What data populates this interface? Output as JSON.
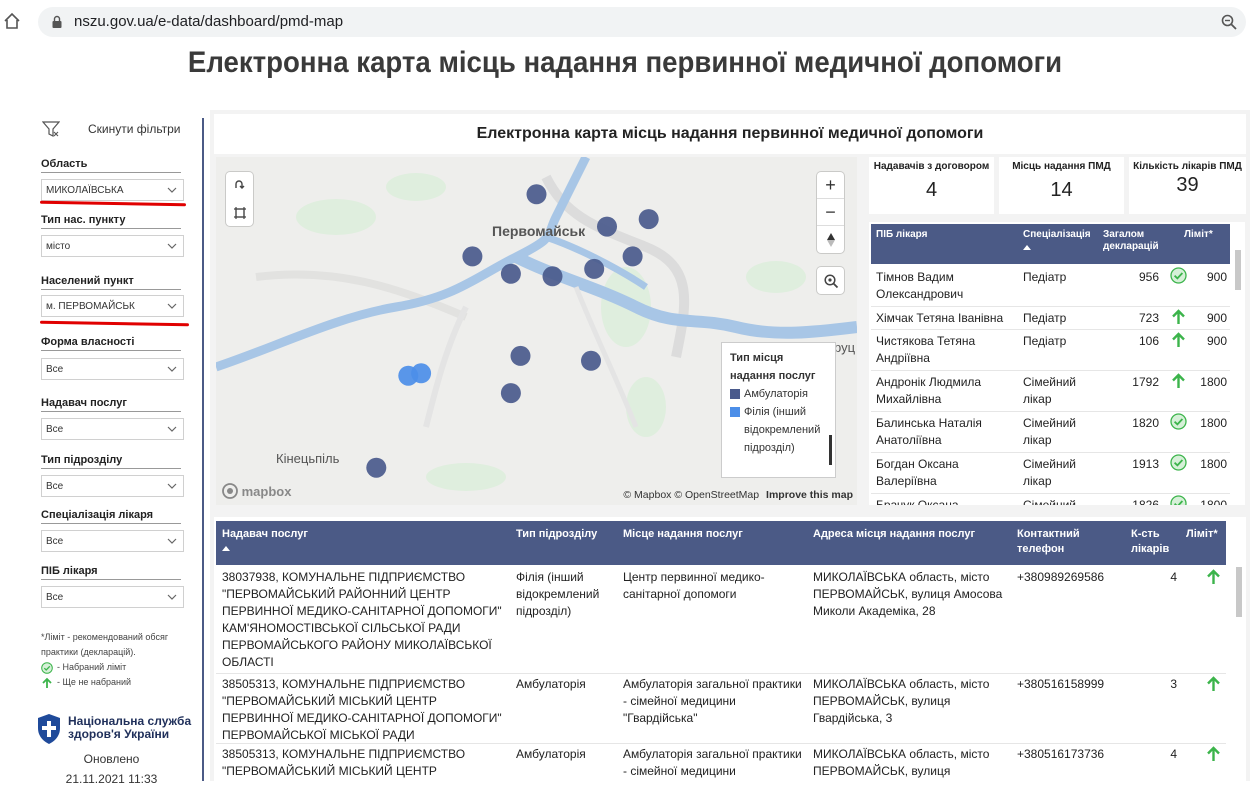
{
  "browser": {
    "url": "nszu.gov.ua/e-data/dashboard/pmd-map"
  },
  "page": {
    "title": "Електронна карта місць надання первинної медичної допомоги"
  },
  "sidebar": {
    "reset_label": "Скинути фільтри",
    "filters": [
      {
        "label": "Область",
        "value": "МИКОЛАЇВСЬКА"
      },
      {
        "label": "Тип нас. пункту",
        "value": "місто"
      },
      {
        "label": "Населений пункт",
        "value": "м. ПЕРВОМАЙСЬК"
      },
      {
        "label": "Форма власності",
        "value": "Все"
      },
      {
        "label": "Надавач послуг",
        "value": "Все"
      },
      {
        "label": "Тип підрозділу",
        "value": "Все"
      },
      {
        "label": "Спеціалізація лікаря",
        "value": "Все"
      },
      {
        "label": "ПІБ лікаря",
        "value": "Все"
      }
    ],
    "note_line1": "*Ліміт - рекомендований обсяг практики (декларацій).",
    "note_reached": "- Набраний ліміт",
    "note_not_reached": "- Ще не набраний",
    "org_name": "Національна служба здоров'я України",
    "updated_label": "Оновлено",
    "updated_value": "21.11.2021 11:33"
  },
  "report": {
    "title": "Електронна карта місць надання первинної медичної допомоги"
  },
  "map": {
    "city_main": "Первомайськ",
    "city_second": "Кінецьпіль",
    "city_edge": "руц",
    "legend_title": "Тип місця надання послуг",
    "legend_items": [
      {
        "label": "Амбулаторія",
        "color": "#4a5a8c"
      },
      {
        "label": "Філія (інший відокремлений підрозділ)",
        "color": "#4c8ee8"
      }
    ],
    "attribution": "© Mapbox © OpenStreetMap",
    "improve": "Improve this map",
    "logo": "mapbox",
    "zoom_in": "+",
    "zoom_out": "−",
    "points": [
      {
        "lon": 30.9,
        "lat": 48.095,
        "type": "Амбулаторія"
      },
      {
        "lon": 30.935,
        "lat": 48.085,
        "type": "Амбулаторія"
      },
      {
        "lon": 30.88,
        "lat": 48.07,
        "type": "Амбулаторія"
      },
      {
        "lon": 30.892,
        "lat": 48.063,
        "type": "Амбулаторія"
      },
      {
        "lon": 30.905,
        "lat": 48.062,
        "type": "Амбулаторія"
      },
      {
        "lon": 30.918,
        "lat": 48.065,
        "type": "Амбулаторія"
      },
      {
        "lon": 30.922,
        "lat": 48.082,
        "type": "Амбулаторія"
      },
      {
        "lon": 30.93,
        "lat": 48.07,
        "type": "Амбулаторія"
      },
      {
        "lon": 30.895,
        "lat": 48.03,
        "type": "Амбулаторія"
      },
      {
        "lon": 30.917,
        "lat": 48.028,
        "type": "Амбулаторія"
      },
      {
        "lon": 30.892,
        "lat": 48.015,
        "type": "Амбулаторія"
      },
      {
        "lon": 30.85,
        "lat": 47.985,
        "type": "Амбулаторія"
      },
      {
        "lon": 30.86,
        "lat": 48.022,
        "type": "Філія (інший відокремлений підрозділ)"
      },
      {
        "lon": 30.864,
        "lat": 48.023,
        "type": "Філія (інший відокремлений підрозділ)"
      }
    ]
  },
  "kpis": [
    {
      "label": "Надавачів з договором",
      "value": "4"
    },
    {
      "label": "Місць надання ПМД",
      "value": "14"
    },
    {
      "label": "Кількість лікарів ПМД",
      "value": "39"
    }
  ],
  "doctors": {
    "headers": {
      "name": "ПІБ лікаря",
      "spec": "Спеціалізація",
      "decl": "Загалом декларацій",
      "limit": "Ліміт*"
    },
    "rows": [
      {
        "name": "Тімнов Вадим Олександрович",
        "spec": "Педіатр",
        "decl": "956",
        "limit": "900",
        "status": "reached"
      },
      {
        "name": "Хімчак Тетяна Іванівна",
        "spec": "Педіатр",
        "decl": "723",
        "limit": "900",
        "status": "not"
      },
      {
        "name": "Чистякова Тетяна Андріївна",
        "spec": "Педіатр",
        "decl": "106",
        "limit": "900",
        "status": "not"
      },
      {
        "name": "Андронік Людмила Михайлівна",
        "spec": "Сімейний лікар",
        "decl": "1792",
        "limit": "1800",
        "status": "not"
      },
      {
        "name": "Балинська Наталія Анатоліївна",
        "spec": "Сімейний лікар",
        "decl": "1820",
        "limit": "1800",
        "status": "reached"
      },
      {
        "name": "Богдан Оксана Валеріївна",
        "spec": "Сімейний лікар",
        "decl": "1913",
        "limit": "1800",
        "status": "reached"
      },
      {
        "name": "Брачук Оксана",
        "spec": "Сімейний",
        "decl": "1826",
        "limit": "1800",
        "status": "reached"
      }
    ]
  },
  "providers": {
    "headers": {
      "provider": "Надавач послуг",
      "type": "Тип підрозділу",
      "place": "Місце надання послуг",
      "address": "Адреса місця надання послуг",
      "phone": "Контактний телефон",
      "count": "К-сть лікарів",
      "limit": "Ліміт*"
    },
    "rows": [
      {
        "provider": "38037938, КОМУНАЛЬНЕ ПІДПРИЄМСТВО \"ПЕРВОМАЙСЬКИЙ РАЙОННИЙ ЦЕНТР ПЕРВИННОЇ МЕДИКО-САНІТАРНОЇ ДОПОМОГИ\" КАМ'ЯНОМОСТІВСЬКОЇ СІЛЬСЬКОЇ РАДИ ПЕРВОМАЙСЬКОГО РАЙОНУ МИКОЛАЇВСЬКОЇ ОБЛАСТІ",
        "type": "Філія (інший відокремлений підрозділ)",
        "place": "Центр первинної медико-санітарної допомоги",
        "address": "МИКОЛАЇВСЬКА область, місто ПЕРВОМАЙСЬК, вулиця Амосова Миколи Академіка, 28",
        "phone": "+380989269586",
        "count": "4"
      },
      {
        "provider": "38505313, КОМУНАЛЬНЕ ПІДПРИЄМСТВО \"ПЕРВОМАЙСЬКИЙ МІСЬКИЙ ЦЕНТР ПЕРВИННОЇ МЕДИКО-САНІТАРНОЇ ДОПОМОГИ\" ПЕРВОМАЙСЬКОЇ МІСЬКОЇ РАДИ",
        "type": "Амбулаторія",
        "place": "Амбулаторія загальної практики - сімейної медицини \"Гвардійська\"",
        "address": "МИКОЛАЇВСЬКА область, місто ПЕРВОМАЙСЬК, вулиця Гвардійська, 3",
        "phone": "+380516158999",
        "count": "3"
      },
      {
        "provider": "38505313, КОМУНАЛЬНЕ ПІДПРИЄМСТВО \"ПЕРВОМАЙСЬКИЙ МІСЬКИЙ ЦЕНТР",
        "type": "Амбулаторія",
        "place": "Амбулаторія загальної практики - сімейної медицини",
        "address": "МИКОЛАЇВСЬКА область, місто ПЕРВОМАЙСЬК, вулиця",
        "phone": "+380516173736",
        "count": "4"
      }
    ]
  },
  "colors": {
    "header": "#4b5a86",
    "ambulatory": "#4a5a8c",
    "branch": "#4c8ee8",
    "ok": "#3cb44b",
    "red": "#e00000"
  }
}
